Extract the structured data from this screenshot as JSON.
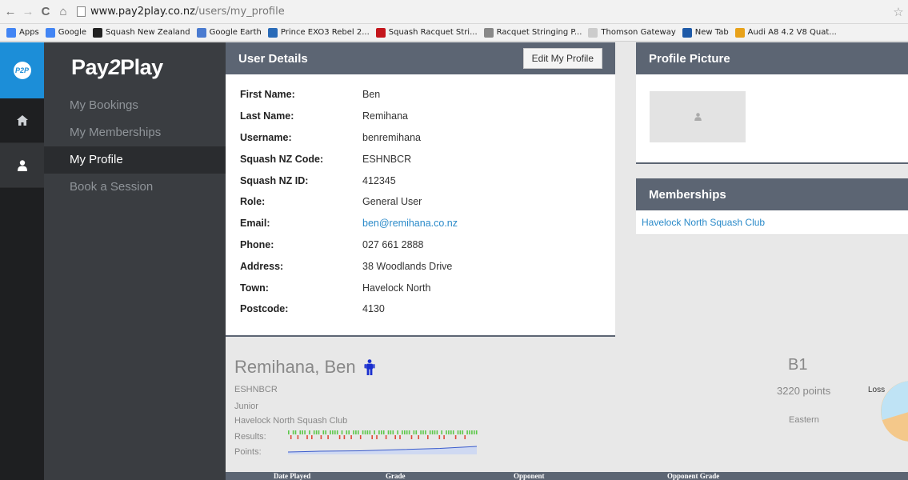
{
  "browser": {
    "url_host": "www.pay2play.co.nz",
    "url_path": "/users/my_profile",
    "bookmarks": [
      {
        "label": "Apps",
        "icon": "apps-grid-icon",
        "color": "#4285f4"
      },
      {
        "label": "Google",
        "icon": "google-icon",
        "color": "#4285f4"
      },
      {
        "label": "Squash New Zealand",
        "icon": "squash-nz-icon",
        "color": "#222222"
      },
      {
        "label": "Google Earth",
        "icon": "google-earth-icon",
        "color": "#4a7bd0"
      },
      {
        "label": "Prince EXO3 Rebel 2...",
        "icon": "bookmark-b-icon",
        "color": "#2a6bb8"
      },
      {
        "label": "Squash Racquet Stri...",
        "icon": "bookmark-w-icon",
        "color": "#c4161c"
      },
      {
        "label": "Racquet Stringing P...",
        "icon": "page-icon",
        "color": "#888888"
      },
      {
        "label": "Thomson Gateway",
        "icon": "thomson-icon",
        "color": "#cccccc"
      },
      {
        "label": "New Tab",
        "icon": "new-tab-icon",
        "color": "#1e5aa8"
      },
      {
        "label": "Audi A8 4.2 V8 Quat...",
        "icon": "audi-icon",
        "color": "#e8a21a"
      }
    ]
  },
  "rail": {
    "logo": "P2P",
    "items": [
      {
        "name": "home",
        "icon": "home-icon"
      },
      {
        "name": "profile",
        "icon": "user-icon"
      }
    ]
  },
  "sidebar": {
    "brand_a": "Pay",
    "brand_b": "2",
    "brand_c": "Play",
    "items": [
      {
        "label": "My Bookings"
      },
      {
        "label": "My Memberships"
      },
      {
        "label": "My Profile"
      },
      {
        "label": "Book a Session"
      }
    ]
  },
  "details": {
    "title": "User Details",
    "edit_label": "Edit My Profile",
    "rows": [
      {
        "key": "First Name:",
        "value": "Ben"
      },
      {
        "key": "Last Name:",
        "value": "Remihana"
      },
      {
        "key": "Username:",
        "value": "benremihana"
      },
      {
        "key": "Squash NZ Code:",
        "value": "ESHNBCR"
      },
      {
        "key": "Squash NZ ID:",
        "value": "412345"
      },
      {
        "key": "Role:",
        "value": "General User"
      },
      {
        "key": "Email:",
        "value": "ben@remihana.co.nz"
      },
      {
        "key": "Phone:",
        "value": "027 661 2888"
      },
      {
        "key": "Address:",
        "value": "38 Woodlands Drive"
      },
      {
        "key": "Town:",
        "value": "Havelock North"
      },
      {
        "key": "Postcode:",
        "value": "4130"
      }
    ]
  },
  "picture": {
    "title": "Profile Picture"
  },
  "memberships": {
    "title": "Memberships",
    "items": [
      "Havelock North Squash Club"
    ]
  },
  "player": {
    "name": "Remihana, Ben",
    "code": "ESHNBCR",
    "category": "Junior",
    "club": "Havelock North Squash Club",
    "results_label": "Results:",
    "points_label": "Points:",
    "grade": "B1",
    "points": "3220 points",
    "region": "Eastern",
    "loss_label": "Loss"
  },
  "results_table": {
    "columns": [
      "Date Played",
      "Grade",
      "Opponent",
      "Opponent Grade"
    ]
  },
  "colors": {
    "accent": "#1c8ed8",
    "header": "#5c6573",
    "link": "#2a8ac9",
    "win": "#5cc84a",
    "loss": "#e04a3a",
    "pie_loss": "#bfe3f5",
    "pie_other": "#f4c88a"
  }
}
